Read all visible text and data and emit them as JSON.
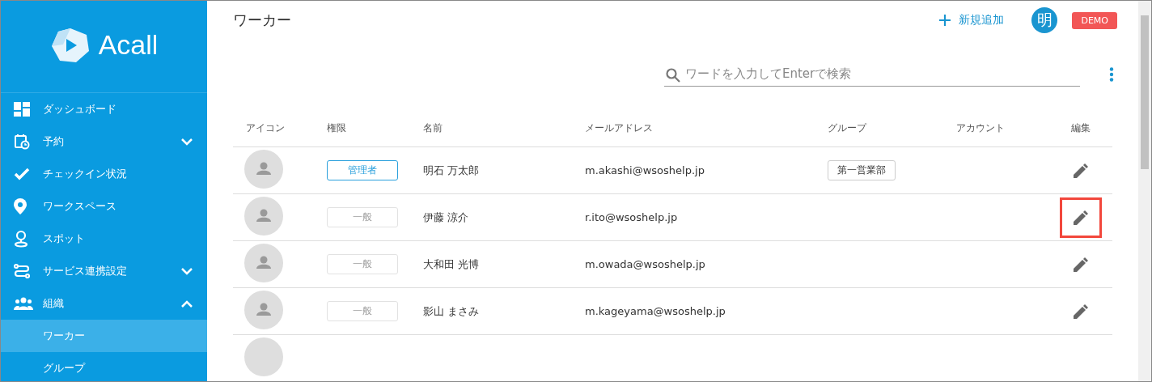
{
  "sidebar": {
    "logo": "Acall",
    "items": [
      {
        "label": "ダッシュボード"
      },
      {
        "label": "予約",
        "expanded": false
      },
      {
        "label": "チェックイン状況"
      },
      {
        "label": "ワークスペース"
      },
      {
        "label": "スポット"
      },
      {
        "label": "サービス連携設定",
        "expanded": false
      },
      {
        "label": "組織",
        "expanded": true,
        "children": [
          {
            "label": "ワーカー",
            "selected": true
          },
          {
            "label": "グループ",
            "selected": false
          }
        ]
      }
    ]
  },
  "header": {
    "title": "ワーカー",
    "add_button": "新規追加",
    "avatar": "明",
    "badge": "DEMO"
  },
  "search": {
    "placeholder": "ワードを入力してEnterで検索"
  },
  "table": {
    "columns": [
      "アイコン",
      "権限",
      "名前",
      "メールアドレス",
      "グループ",
      "アカウント",
      "編集"
    ],
    "rows": [
      {
        "role": "管理者",
        "role_disabled": false,
        "name": "明石 万太郎",
        "email": "m.akashi@wsoshelp.jp",
        "group": "第一営業部",
        "edit_highlighted": false
      },
      {
        "role": "一般",
        "role_disabled": true,
        "name": "伊藤 涼介",
        "email": "r.ito@wsoshelp.jp",
        "edit_highlighted": true
      },
      {
        "role": "一般",
        "role_disabled": true,
        "name": "大和田 光博",
        "email": "m.owada@wsoshelp.jp",
        "edit_highlighted": false
      },
      {
        "role": "一般",
        "role_disabled": true,
        "name": "影山 まさみ",
        "email": "m.kageyama@wsoshelp.jp",
        "edit_highlighted": false
      }
    ]
  }
}
